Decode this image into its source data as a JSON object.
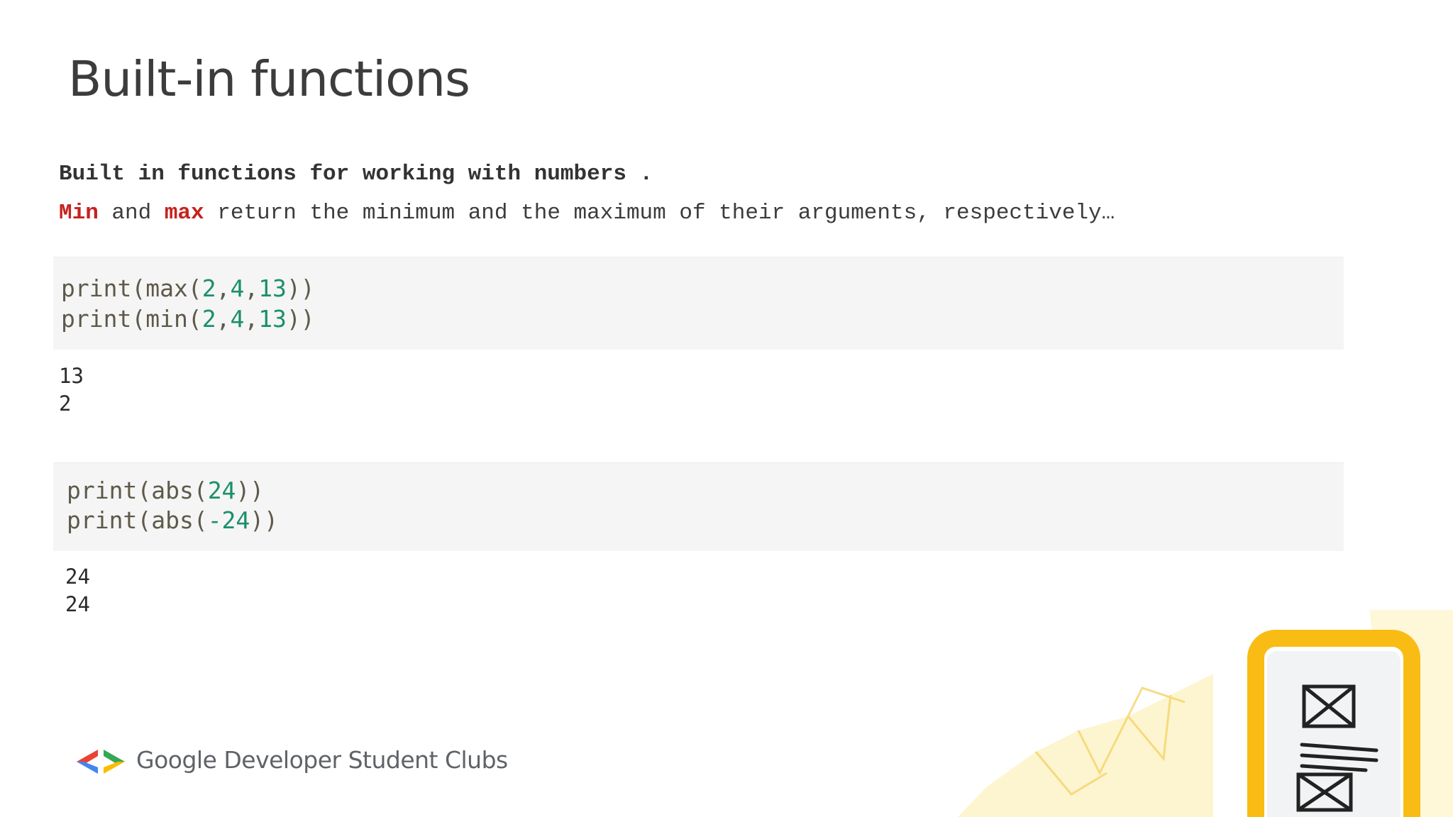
{
  "slide": {
    "title": "Built-in functions",
    "subheading": "Built in functions for working with numbers .",
    "description": {
      "min_kw": "Min",
      "and1": " and ",
      "max_kw": "max",
      "rest": " return the minimum and the maximum of their arguments, respectively…"
    },
    "code_block_1": [
      {
        "prefix": "print(max(",
        "n1": "2",
        "c1": ",",
        "n2": "4",
        "c2": ",",
        "n3": "13",
        "suffix": "))"
      },
      {
        "prefix": "print(min(",
        "n1": "2",
        "c1": ",",
        "n2": "4",
        "c2": ",",
        "n3": "13",
        "suffix": "))"
      }
    ],
    "output_1": [
      "13",
      "2"
    ],
    "code_block_2": [
      {
        "prefix": "print(abs(",
        "n1": "24",
        "suffix": "))"
      },
      {
        "prefix": "print(abs(",
        "n1": "-24",
        "suffix": "))"
      }
    ],
    "output_2": [
      "24",
      "24"
    ],
    "footer": {
      "brand": "Google Developer Student Clubs"
    }
  },
  "colors": {
    "keyword_red": "#c5221f",
    "number_green": "#1a8f6b",
    "code_bg": "#f5f5f5",
    "accent_yellow": "#f9bc15",
    "logo_red": "#ea4335",
    "logo_blue": "#4285f4",
    "logo_green": "#34a853",
    "logo_yellow": "#fbbc04"
  }
}
